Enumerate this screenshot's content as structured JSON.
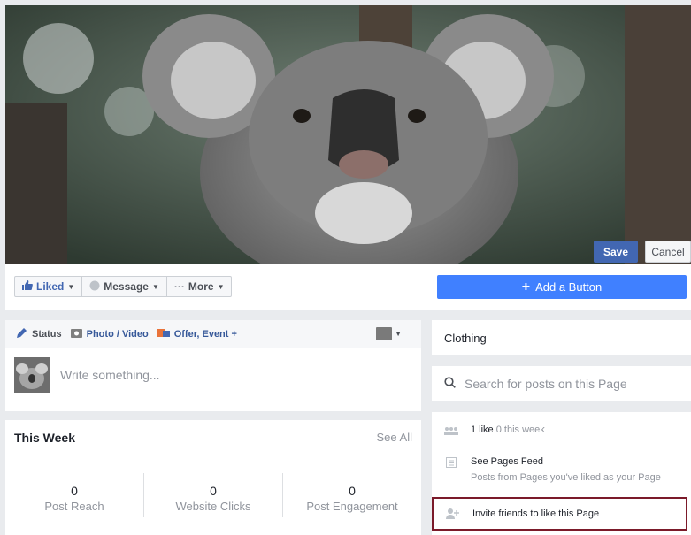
{
  "cover": {
    "save_label": "Save",
    "cancel_label": "Cancel"
  },
  "action_bar": {
    "liked_label": "Liked",
    "message_label": "Message",
    "more_label": "More",
    "add_button_label": "Add a Button"
  },
  "composer": {
    "tabs": [
      "Status",
      "Photo / Video",
      "Offer, Event +"
    ],
    "placeholder": "Write something..."
  },
  "this_week": {
    "title": "This Week",
    "see_all": "See All",
    "stats": [
      {
        "value": "0",
        "label": "Post Reach"
      },
      {
        "value": "0",
        "label": "Website Clicks"
      },
      {
        "value": "0",
        "label": "Post Engagement"
      }
    ]
  },
  "sidebar": {
    "category": "Clothing",
    "search_placeholder": "Search for posts on this Page",
    "likes_count": "1 like",
    "likes_week": "0 this week",
    "feed_title": "See Pages Feed",
    "feed_subtitle": "Posts from Pages you've liked as your Page",
    "invite_label": "Invite friends to like this Page"
  },
  "colors": {
    "brand_blue": "#4267b2",
    "add_button_blue": "#4080ff",
    "highlight_border": "#7b1a2a"
  }
}
